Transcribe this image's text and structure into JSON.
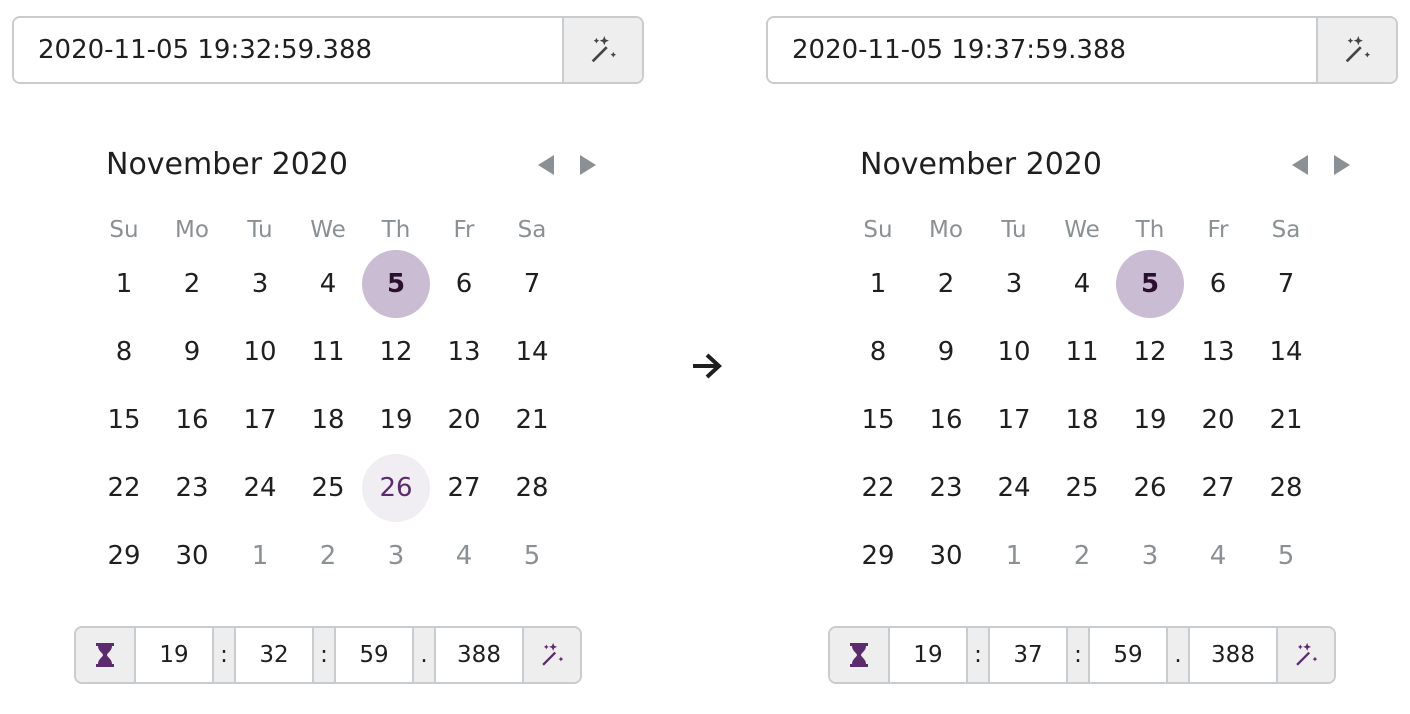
{
  "colors": {
    "accent": "#5b2b6d",
    "selected_bg": "#c9bcd3",
    "today_bg": "#f1eef3",
    "muted": "#8a9093",
    "border": "#c9cccf"
  },
  "transition_icon": "arrow-right-icon",
  "weekdays": [
    "Su",
    "Mo",
    "Tu",
    "We",
    "Th",
    "Fr",
    "Sa"
  ],
  "pickers": [
    {
      "datetime_value": "2020-11-05 19:32:59.388",
      "calendar_title": "November 2020",
      "selected_day": "5",
      "today_day": "26",
      "days": [
        "1",
        "2",
        "3",
        "4",
        "5",
        "6",
        "7",
        "8",
        "9",
        "10",
        "11",
        "12",
        "13",
        "14",
        "15",
        "16",
        "17",
        "18",
        "19",
        "20",
        "21",
        "22",
        "23",
        "24",
        "25",
        "26",
        "27",
        "28",
        "29",
        "30",
        "1",
        "2",
        "3",
        "4",
        "5"
      ],
      "time": {
        "hour": "19",
        "minute": "32",
        "second": "59",
        "ms": "388",
        "sep1": ":",
        "sep2": ":",
        "sep3": "."
      }
    },
    {
      "datetime_value": "2020-11-05 19:37:59.388",
      "calendar_title": "November 2020",
      "selected_day": "5",
      "today_day": "",
      "days": [
        "1",
        "2",
        "3",
        "4",
        "5",
        "6",
        "7",
        "8",
        "9",
        "10",
        "11",
        "12",
        "13",
        "14",
        "15",
        "16",
        "17",
        "18",
        "19",
        "20",
        "21",
        "22",
        "23",
        "24",
        "25",
        "26",
        "27",
        "28",
        "29",
        "30",
        "1",
        "2",
        "3",
        "4",
        "5"
      ],
      "time": {
        "hour": "19",
        "minute": "37",
        "second": "59",
        "ms": "388",
        "sep1": ":",
        "sep2": ":",
        "sep3": "."
      }
    }
  ]
}
